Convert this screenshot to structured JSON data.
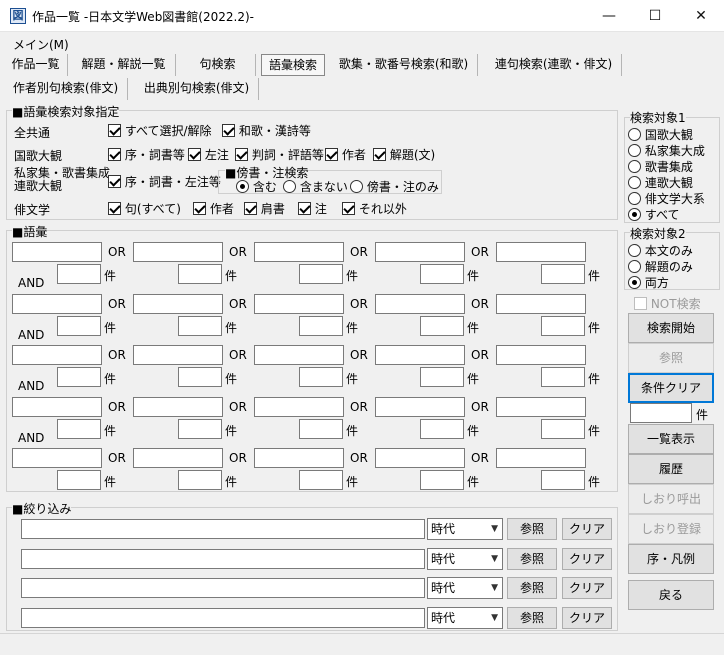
{
  "window": {
    "title": "作品一覧 -日本文学Web図書館(2022.2)-",
    "minimize": "—",
    "maximize": "☐",
    "close": "✕"
  },
  "menu": {
    "main": "メイン(M)"
  },
  "tabs": [
    {
      "label": "作品一覧"
    },
    {
      "label": "解題・解説一覧"
    },
    {
      "label": "句検索"
    },
    {
      "label": "語彙検索"
    },
    {
      "label": "歌集・歌番号検索(和歌)"
    },
    {
      "label": "連句検索(連歌・俳文)"
    },
    {
      "label": "作者別句検索(俳文)"
    },
    {
      "label": "出典別句検索(俳文)"
    }
  ],
  "target_spec": {
    "title": "■語彙検索対象指定",
    "rows": {
      "all": {
        "label": "全共通",
        "options": [
          {
            "label": "すべて選択/解除",
            "checked": true
          },
          {
            "label": "和歌・漢詩等",
            "checked": true
          }
        ]
      },
      "kokka": {
        "label": "国歌大観",
        "options": [
          {
            "label": "序・詞書等",
            "checked": true
          },
          {
            "label": "左注",
            "checked": true
          },
          {
            "label": "判詞・評語等",
            "checked": true
          },
          {
            "label": "作者",
            "checked": true
          },
          {
            "label": "解題(文)",
            "checked": true
          }
        ]
      },
      "shika": {
        "label_line1": "私家集・歌書集成",
        "label_line2": "連歌大観",
        "options": [
          {
            "label": "序・詞書・左注等",
            "checked": true
          }
        ]
      },
      "haibun": {
        "label": "俳文学",
        "options": [
          {
            "label": "句(すべて)",
            "checked": true
          },
          {
            "label": "作者",
            "checked": true
          },
          {
            "label": "肩書",
            "checked": true
          },
          {
            "label": "注",
            "checked": true
          },
          {
            "label": "それ以外",
            "checked": true
          }
        ]
      }
    },
    "bosho": {
      "title": "■傍書・注検索",
      "options": [
        {
          "label": "含む",
          "selected": true
        },
        {
          "label": "含まない",
          "selected": false
        },
        {
          "label": "傍書・注のみ",
          "selected": false
        }
      ]
    }
  },
  "vocab": {
    "title": "■語彙",
    "or_label": "OR",
    "and_label": "AND",
    "count_unit": "件"
  },
  "filter": {
    "title": "■絞り込み",
    "era_select": "時代",
    "ref_button": "参照",
    "clear_button": "クリア"
  },
  "target1": {
    "title": "検索対象1",
    "options": [
      {
        "label": "国歌大観",
        "selected": false
      },
      {
        "label": "私家集大成",
        "selected": false
      },
      {
        "label": "歌書集成",
        "selected": false
      },
      {
        "label": "連歌大観",
        "selected": false
      },
      {
        "label": "俳文学大系",
        "selected": false
      },
      {
        "label": "すべて",
        "selected": true
      }
    ]
  },
  "target2": {
    "title": "検索対象2",
    "options": [
      {
        "label": "本文のみ",
        "selected": false
      },
      {
        "label": "解題のみ",
        "selected": false
      },
      {
        "label": "両方",
        "selected": true
      }
    ]
  },
  "side": {
    "not_search": "NOT検索",
    "search_start": "検索開始",
    "reference": "参照",
    "clear_conditions": "条件クリア",
    "count_unit": "件",
    "list_view": "一覧表示",
    "history": "履歴",
    "bookmark_load": "しおり呼出",
    "bookmark_save": "しおり登録",
    "legend": "序・凡例",
    "back": "戻る"
  }
}
